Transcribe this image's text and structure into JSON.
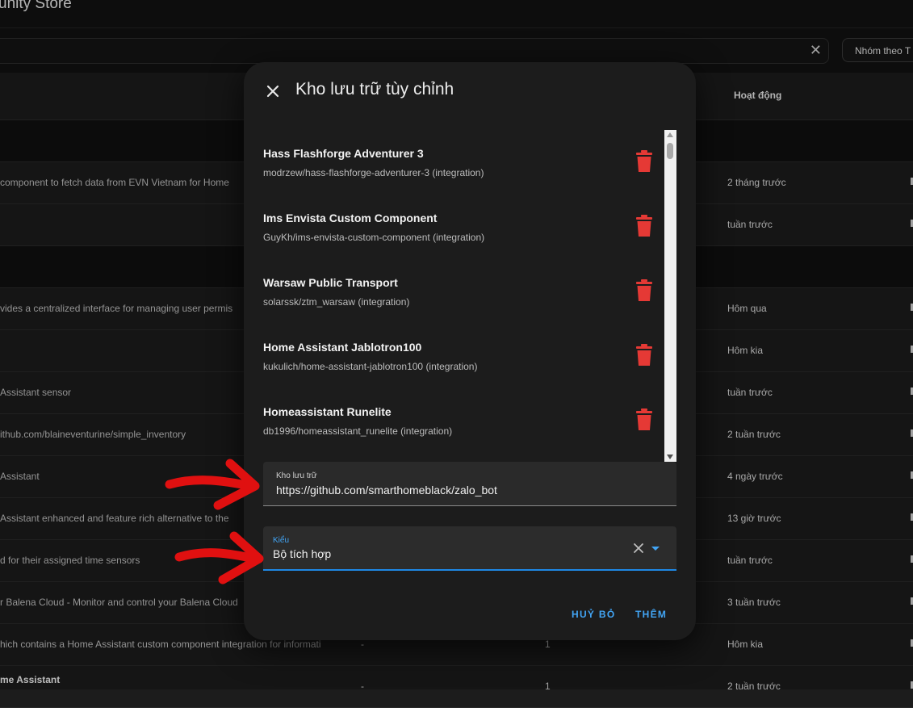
{
  "page": {
    "title": "unity Store",
    "search_clear": "✕",
    "group_by_label": "Nhóm theo T",
    "column_activity": "Hoạt động"
  },
  "rows": [
    {
      "desc": "",
      "time": "",
      "group": true
    },
    {
      "desc": "component to fetch data from EVN Vietnam for Home",
      "time": "2 tháng trước"
    },
    {
      "desc": "",
      "time": "tuần trước"
    },
    {
      "desc": "",
      "time": "",
      "group": true
    },
    {
      "desc": "vides a centralized interface for managing user permis",
      "time": "Hôm qua"
    },
    {
      "desc": "",
      "time": "Hôm kia"
    },
    {
      "desc": "Assistant sensor",
      "time": "tuần trước"
    },
    {
      "desc": "ithub.com/blaineventurine/simple_inventory",
      "time": "2 tuần trước"
    },
    {
      "desc": "Assistant",
      "time": "4 ngày trước"
    },
    {
      "desc": "Assistant enhanced and feature rich alternative to the",
      "time": "13 giờ trước"
    },
    {
      "desc": "d for their assigned time sensors",
      "time": "tuần trước"
    },
    {
      "desc": "r Balena Cloud - Monitor and control your Balena Cloud",
      "time": "3 tuần trước"
    },
    {
      "desc": "hich contains a Home Assistant custom component integration for informati",
      "dash": "-",
      "num": "1",
      "time": "Hôm kia"
    },
    {
      "title": "me Assistant",
      "dash": "-",
      "num": "1",
      "time": "2 tuần trước"
    }
  ],
  "dialog": {
    "title": "Kho lưu trữ tùy chỉnh",
    "repos": [
      {
        "name": "Hass Flashforge Adventurer 3",
        "sub": "modrzew/hass-flashforge-adventurer-3 (integration)"
      },
      {
        "name": "Ims Envista Custom Component",
        "sub": "GuyKh/ims-envista-custom-component (integration)"
      },
      {
        "name": "Warsaw Public Transport",
        "sub": "solarssk/ztm_warsaw (integration)"
      },
      {
        "name": "Home Assistant Jablotron100",
        "sub": "kukulich/home-assistant-jablotron100 (integration)"
      },
      {
        "name": "Homeassistant Runelite",
        "sub": "db1996/homeassistant_runelite (integration)"
      }
    ],
    "repo_field": {
      "label": "Kho lưu trữ",
      "value": "https://github.com/smarthomeblack/zalo_bot"
    },
    "kind_field": {
      "label": "Kiểu",
      "value": "Bộ tích hợp"
    },
    "cancel_label": "HUỶ BỎ",
    "add_label": "THÊM"
  },
  "colors": {
    "accent": "#42a5f5",
    "delete": "#e53935",
    "annotation_arrow": "#e01010"
  }
}
